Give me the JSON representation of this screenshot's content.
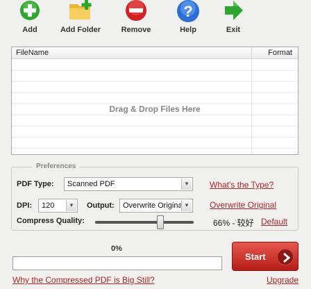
{
  "toolbar": {
    "add": {
      "label": "Add",
      "icon": "add-icon",
      "color": "#2ea52e"
    },
    "add_folder": {
      "label": "Add Folder",
      "icon": "add-folder-icon",
      "color": "#e8b830"
    },
    "remove": {
      "label": "Remove",
      "icon": "remove-icon",
      "color": "#d42020"
    },
    "help": {
      "label": "Help",
      "icon": "help-icon",
      "color": "#2a6fd6"
    },
    "exit": {
      "label": "Exit",
      "icon": "exit-icon",
      "color": "#2ea52e"
    }
  },
  "filelist": {
    "columns": [
      "FileName",
      "Format"
    ],
    "drop_hint": "Drag & Drop Files Here"
  },
  "preferences": {
    "legend": "Preferences",
    "pdf_type_label": "PDF Type:",
    "pdf_type_value": "Scanned PDF",
    "whats_the_type_link": "What's the Type?",
    "dpi_label": "DPI:",
    "dpi_value": "120",
    "output_label": "Output:",
    "output_value": "Overwrite Origina",
    "overwrite_original_link": "Overwrite Original",
    "quality_label": "Compress Quality:",
    "quality_value": 0.66,
    "quality_text": "66% - 较好",
    "default_link": "Default"
  },
  "progress": {
    "percent_text": "0%",
    "value": 0
  },
  "start": {
    "label": "Start",
    "icon": "arrow-right-icon",
    "color": "#c8231c"
  },
  "footer": {
    "why_link": "Why the Compressed PDF is Big Still?",
    "upgrade_link": "Upgrade"
  }
}
